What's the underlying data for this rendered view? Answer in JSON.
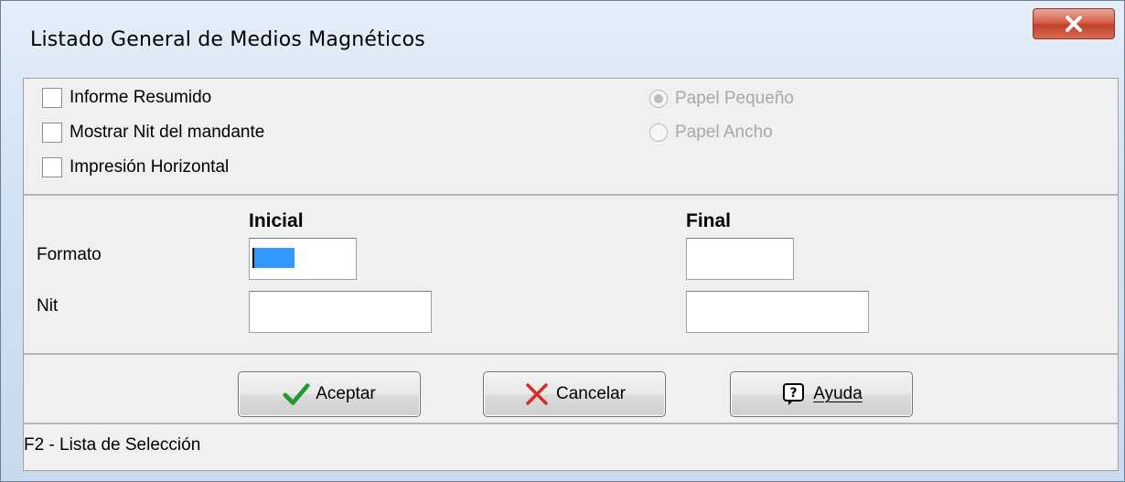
{
  "window": {
    "title": "Listado General de Medios Magnéticos"
  },
  "options": {
    "checkboxes": [
      {
        "label": "Informe Resumido",
        "checked": false
      },
      {
        "label": "Mostrar Nit del mandante",
        "checked": false
      },
      {
        "label": "Impresión Horizontal",
        "checked": false
      }
    ],
    "paper": [
      {
        "label": "Papel Pequeño",
        "selected": true,
        "disabled": true
      },
      {
        "label": "Papel Ancho",
        "selected": false,
        "disabled": true
      }
    ]
  },
  "range": {
    "col_initial": "Inicial",
    "col_final": "Final",
    "rows": [
      {
        "label": "Formato",
        "initial": "",
        "final": ""
      },
      {
        "label": "Nit",
        "initial": "",
        "final": ""
      }
    ]
  },
  "buttons": {
    "accept": {
      "label": "Aceptar",
      "icon": "checkmark-icon"
    },
    "cancel": {
      "label": "Cancelar",
      "icon": "x-icon"
    },
    "help": {
      "label": "Ayuda",
      "icon": "help-icon"
    }
  },
  "status": {
    "text": "F2 - Lista de Selección"
  },
  "colors": {
    "selection": "#3399ff",
    "close": "#c0412b",
    "disabled_text": "#a8a8a8"
  }
}
